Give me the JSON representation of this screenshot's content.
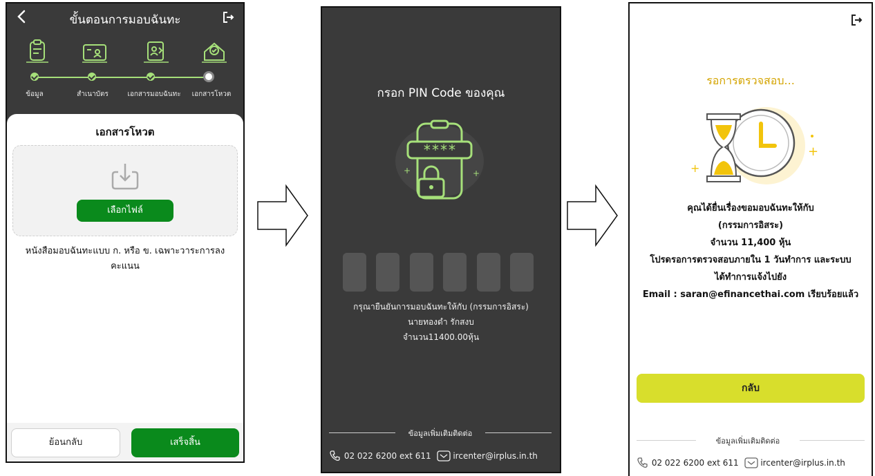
{
  "screen1": {
    "title": "ขั้นตอนการมอบฉันทะ",
    "steps": [
      {
        "label": "ข้อมูล",
        "icon": "document-icon"
      },
      {
        "label": "สำเนาบัตร",
        "icon": "id-card-icon"
      },
      {
        "label": "เอกสารมอบฉันทะ",
        "icon": "proxy-document-icon"
      },
      {
        "label": "เอกสารโหวต",
        "icon": "vote-box-icon"
      }
    ],
    "panel_title": "เอกสารโหวต",
    "choose_file": "เลือกไฟล์",
    "description": "หนังสือมอบฉันทะแบบ ก. หรือ ข. เฉพาะวาระการลงคะแนน",
    "back_button": "ย้อนกลับ",
    "finish_button": "เสร็จสิ้น"
  },
  "screen2": {
    "title": "กรอก PIN Code ของคุณ",
    "pin_mask": "****",
    "confirm_lines": [
      "กรุณายืนยันการมอบฉันทะให้กับ (กรรมการอิสระ)",
      "นายทองดำ รักสงบ",
      "จำนวน11400.00หุ้น"
    ]
  },
  "screen3": {
    "title": "รอการตรวจสอบ...",
    "result_lines": [
      "คุณได้ยื่นเรื่องขอมอบฉันทะให้กับ",
      "(กรรมการอิสระ)",
      "จำนวน 11,400 หุ้น",
      "โปรดรอการตรวจสอบภายใน 1 วันทำการ และระบบ",
      "ได้ทำการแจ้งไปยัง",
      "Email : saran@efinancethai.com เรียบร้อยแล้ว"
    ],
    "back_button": "กลับ"
  },
  "contact": {
    "label": "ข้อมูลเพิ่มเติมติดต่อ",
    "phone": "02 022 6200 ext 611",
    "email": "ircenter@irplus.in.th"
  },
  "colors": {
    "dark_bg": "#3a3a3a",
    "primary_green": "#0a8a1c",
    "step_green": "#a6e07a",
    "accent_yellow": "#d8de2c",
    "wait_title": "#d4a400"
  }
}
